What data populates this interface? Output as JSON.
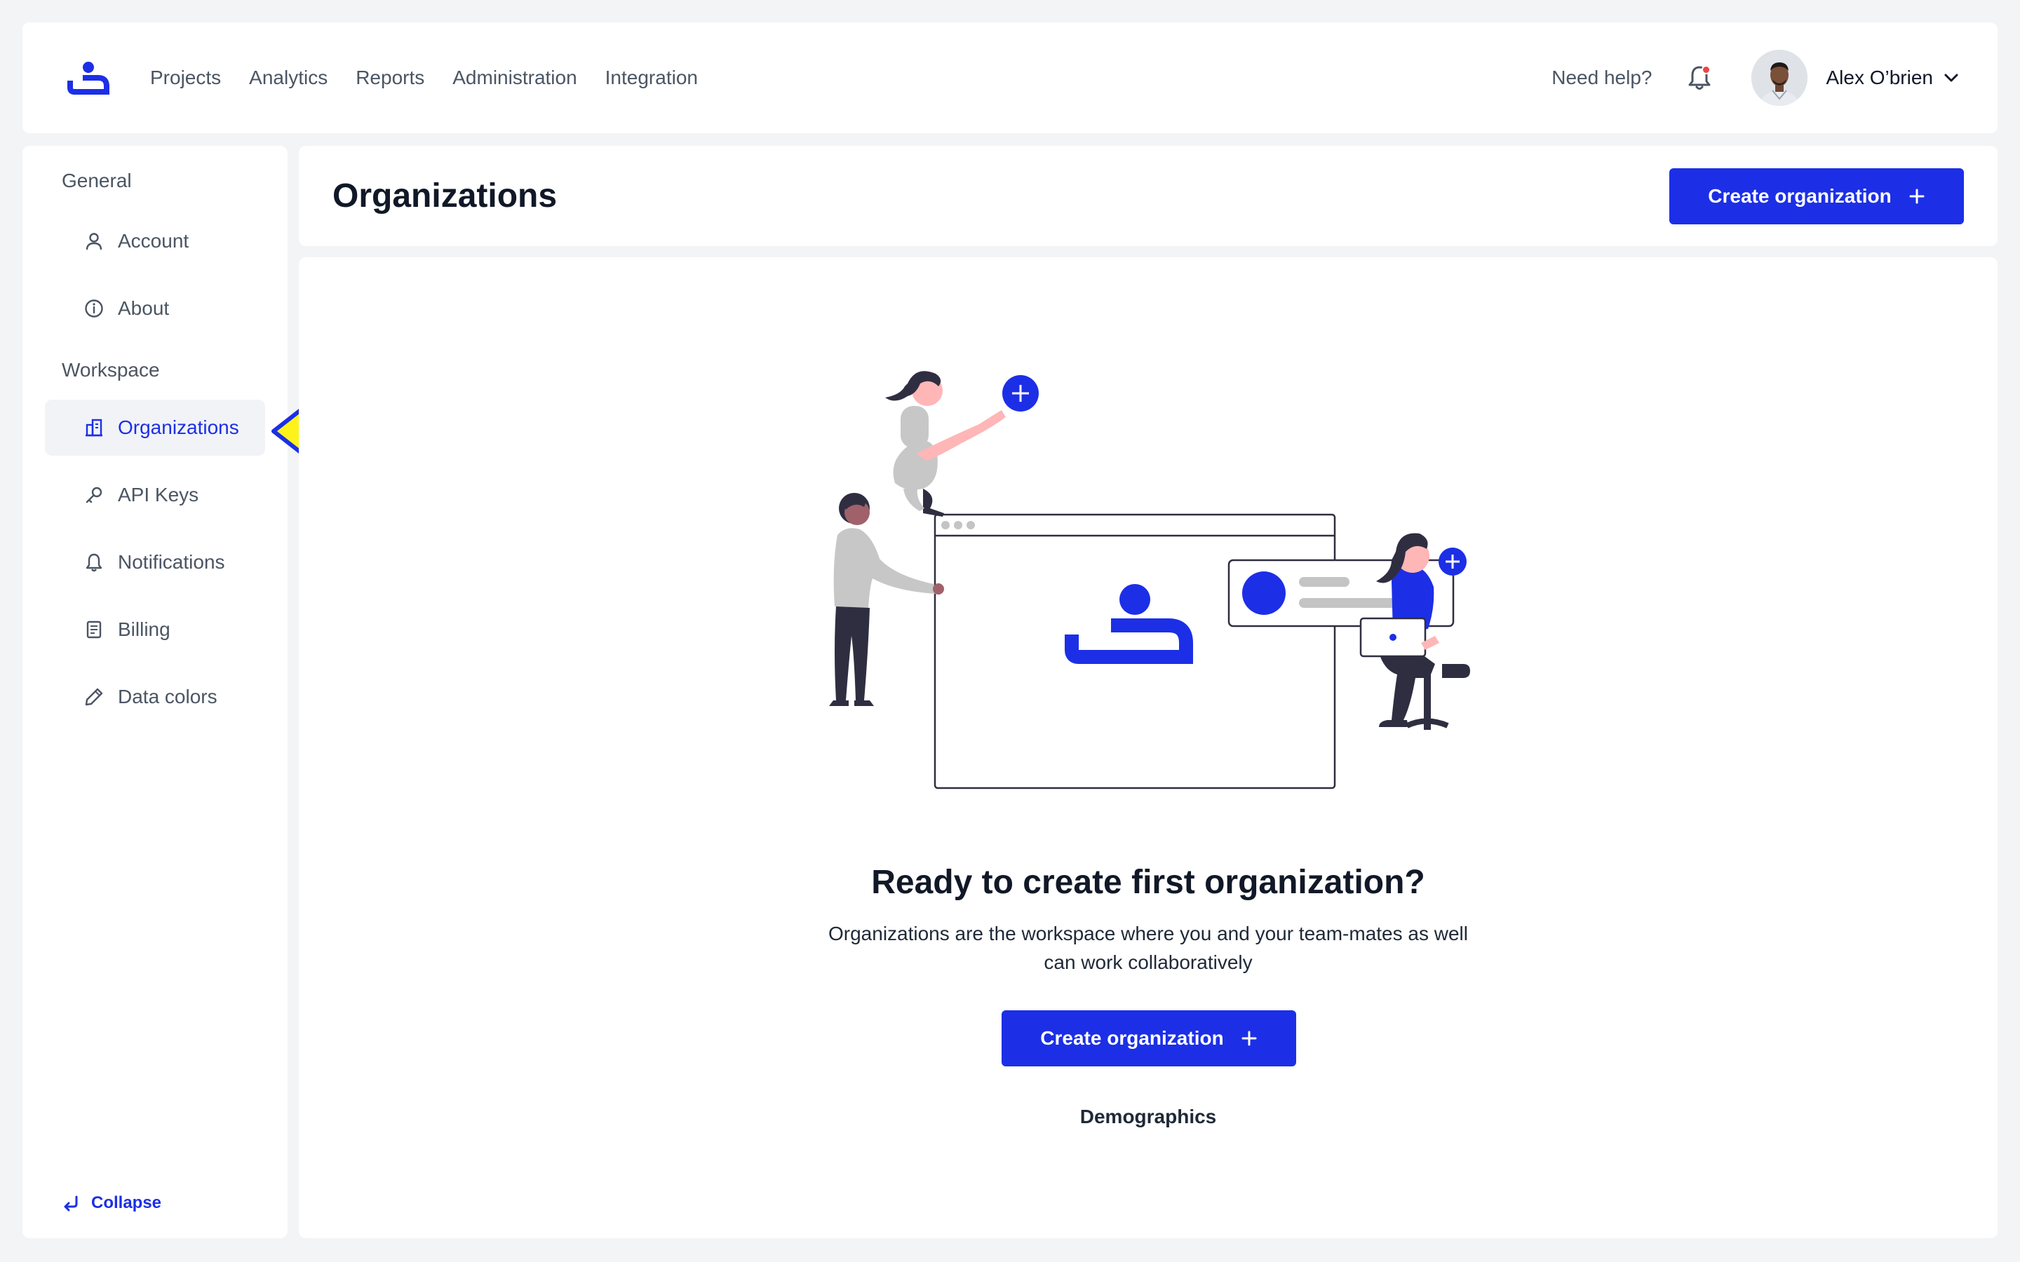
{
  "topbar": {
    "nav": [
      "Projects",
      "Analytics",
      "Reports",
      "Administration",
      "Integration"
    ],
    "help": "Need help?",
    "user_name": "Alex O’brien",
    "accent": "#1c2fe6",
    "notification_dot": "#ef4444"
  },
  "sidebar": {
    "sections": {
      "general": "General",
      "workspace": "Workspace"
    },
    "items": [
      {
        "label": "Account",
        "icon": "user-icon"
      },
      {
        "label": "About",
        "icon": "info-icon"
      },
      {
        "label": "Organizations",
        "icon": "building-icon",
        "active": true
      },
      {
        "label": "API Keys",
        "icon": "key-icon"
      },
      {
        "label": "Notifications",
        "icon": "bell-icon"
      },
      {
        "label": "Billing",
        "icon": "receipt-icon"
      },
      {
        "label": "Data colors",
        "icon": "pen-icon"
      }
    ],
    "collapse": "Collapse"
  },
  "page": {
    "title": "Organizations",
    "create_button": "Create organization"
  },
  "empty_state": {
    "title": "Ready to create first organization?",
    "description": "Organizations are the workspace where you and your team-mates as well can work collaboratively",
    "button": "Create organization",
    "link": "Demographics"
  }
}
